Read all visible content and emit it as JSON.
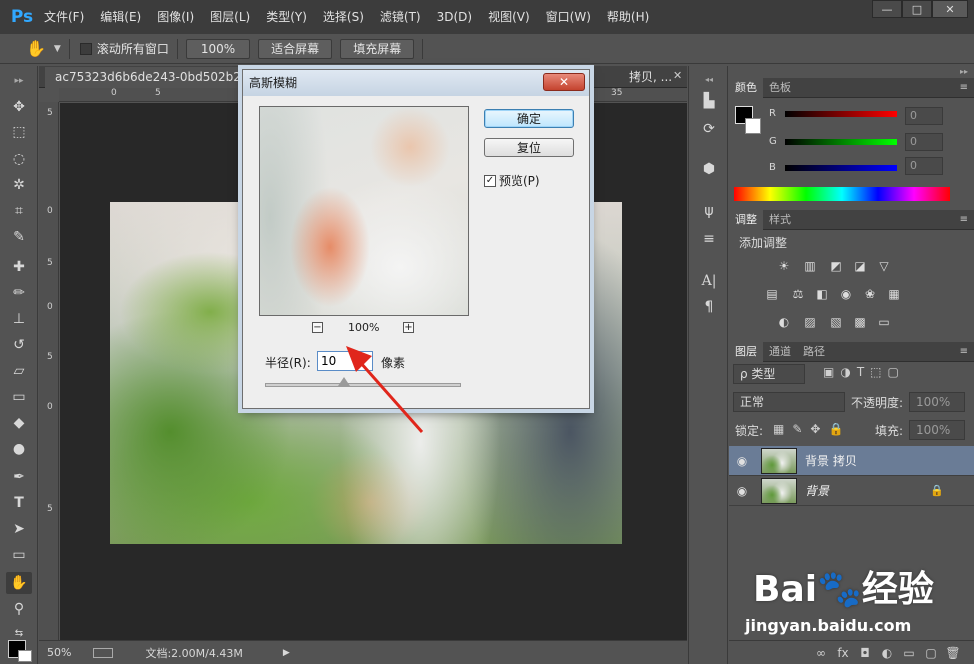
{
  "app": {
    "logo": "Ps"
  },
  "menu": [
    "文件(F)",
    "编辑(E)",
    "图像(I)",
    "图层(L)",
    "类型(Y)",
    "选择(S)",
    "滤镜(T)",
    "3D(D)",
    "视图(V)",
    "窗口(W)",
    "帮助(H)"
  ],
  "window_controls": {
    "minimize": "—",
    "maximize": "□",
    "close": "✕"
  },
  "options_bar": {
    "scroll_all_label": "滚动所有窗口",
    "zoom_100": "100%",
    "fit_screen": "适合屏幕",
    "fill_screen": "填充屏幕"
  },
  "document": {
    "tab_title": "ac75323d6b6de243-0bd502b2bd",
    "tab_title_right": "拷贝, ...",
    "ruler_top_ticks": [
      "0",
      "5",
      "35"
    ],
    "ruler_left_ticks": [
      "5",
      "0",
      "5",
      "0",
      "5",
      "0",
      "5"
    ],
    "status_zoom": "50%",
    "status_doc": "文档:2.00M/4.43M"
  },
  "dialog": {
    "title": "高斯模糊",
    "close": "✕",
    "ok": "确定",
    "reset": "复位",
    "preview_label": "预览(P)",
    "preview_checked": true,
    "zoom_level": "100%",
    "zoom_out": "−",
    "zoom_in": "+",
    "radius_label": "半径(R):",
    "radius_value": "10",
    "radius_unit": "像素"
  },
  "color_panel": {
    "tabs": [
      "颜色",
      "色板"
    ],
    "channels": [
      {
        "label": "R",
        "value": "0"
      },
      {
        "label": "G",
        "value": "0"
      },
      {
        "label": "B",
        "value": "0"
      }
    ]
  },
  "adjust_panel": {
    "tabs": [
      "调整",
      "样式"
    ],
    "heading": "添加调整"
  },
  "layers_panel": {
    "tabs": [
      "图层",
      "通道",
      "路径"
    ],
    "kind_filter": "ρ 类型",
    "blend_mode": "正常",
    "opacity_label": "不透明度:",
    "opacity_value": "100%",
    "lock_label": "锁定:",
    "fill_label": "填充:",
    "fill_value": "100%",
    "layers": [
      {
        "name": "背景 拷贝",
        "selected": true,
        "locked": false
      },
      {
        "name": "背景",
        "selected": false,
        "locked": true
      }
    ]
  },
  "watermark": {
    "text": "Bai",
    "text2": "经验",
    "url": "jingyan.baidu.com"
  }
}
